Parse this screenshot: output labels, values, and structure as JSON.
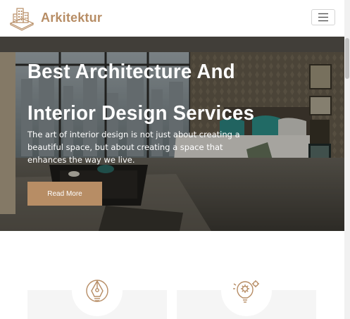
{
  "navbar": {
    "brand_name": "Arkitektur",
    "logo_icon": "building-logo-icon",
    "menu_icon": "hamburger-menu-icon"
  },
  "hero": {
    "title_line1": "Best Architecture And",
    "title_line2": "Interior Design Services",
    "text": "The art of interior design is not just about creating a beautiful space, but about creating a space that enhances the way we live.",
    "button_label": "Read More"
  },
  "services": [
    {
      "icon": "pen-tool-icon"
    },
    {
      "icon": "gear-lightbulb-icon"
    }
  ],
  "colors": {
    "accent": "#b78d65",
    "card_bg": "#f5f5f5",
    "white": "#ffffff"
  }
}
